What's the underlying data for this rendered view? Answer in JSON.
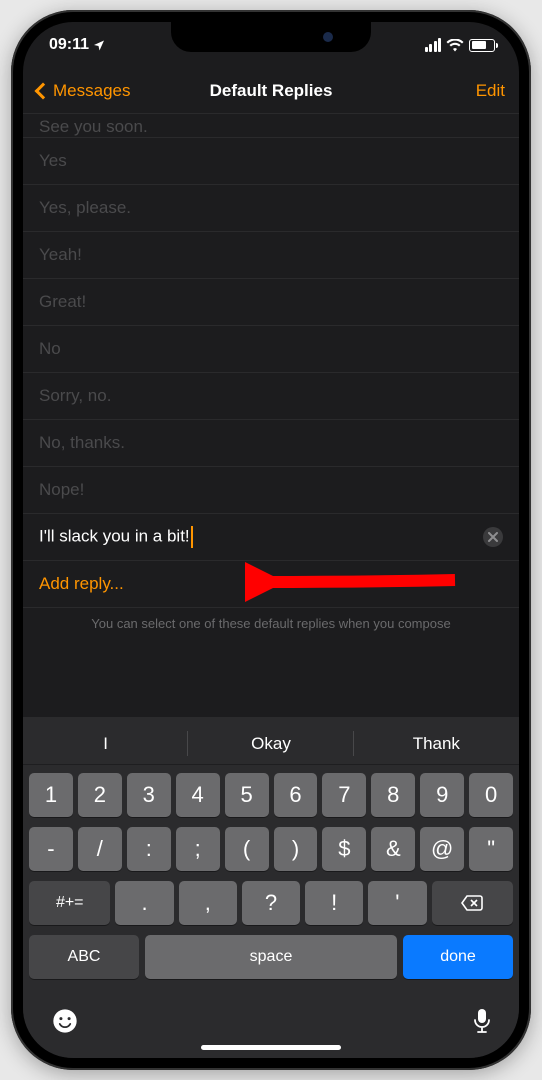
{
  "status": {
    "time": "09:11"
  },
  "nav": {
    "back_label": "Messages",
    "title": "Default Replies",
    "edit_label": "Edit"
  },
  "replies": [
    "See you soon.",
    "Yes",
    "Yes, please.",
    "Yeah!",
    "Great!",
    "No",
    "Sorry, no.",
    "No, thanks.",
    "Nope!"
  ],
  "input": {
    "value": "I'll slack you in a bit!"
  },
  "add_reply_label": "Add reply...",
  "footer": "You can select one of these default replies when you compose",
  "suggestions": [
    "I",
    "Okay",
    "Thank"
  ],
  "keyboard": {
    "row1": [
      "1",
      "2",
      "3",
      "4",
      "5",
      "6",
      "7",
      "8",
      "9",
      "0"
    ],
    "row2": [
      "-",
      "/",
      ":",
      ";",
      "(",
      ")",
      "$",
      "&",
      "@",
      "\""
    ],
    "row3_mode": "#+=",
    "row3": [
      ".",
      ",",
      "?",
      "!",
      "'"
    ],
    "abc": "ABC",
    "space": "space",
    "done": "done"
  }
}
